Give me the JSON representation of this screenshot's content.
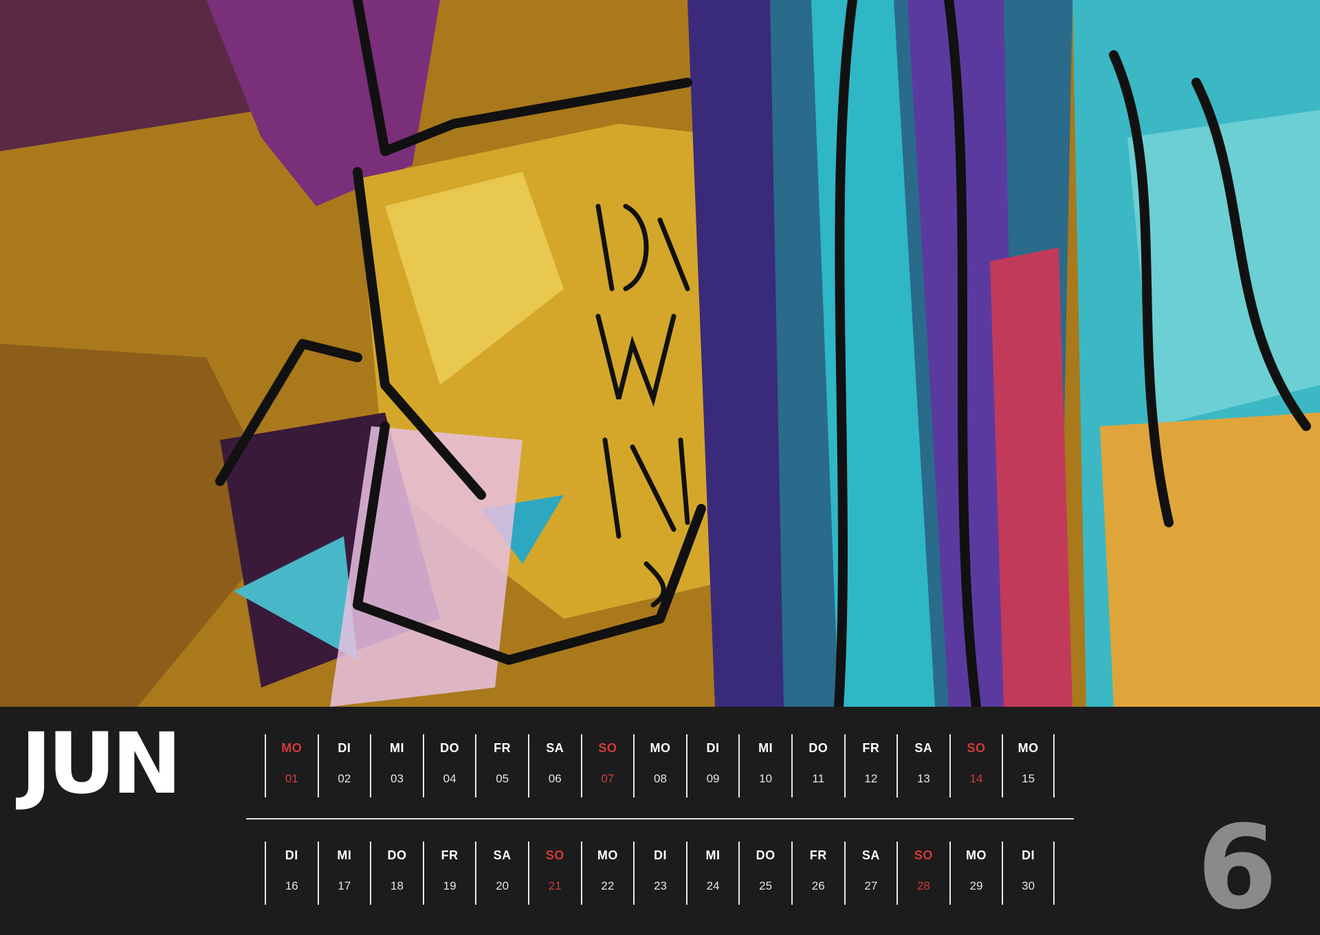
{
  "month": {
    "name": "JUN",
    "number": "6"
  },
  "colors": {
    "background": "#1c1c1c",
    "text": "#ffffff",
    "sunday": "#d23a3a",
    "month_number": "#8a8a8a"
  },
  "photo": {
    "subject": "graffiti-wall-photo"
  },
  "weeks": [
    [
      {
        "weekday": "MO",
        "day": "01",
        "sunday": true
      },
      {
        "weekday": "DI",
        "day": "02",
        "sunday": false
      },
      {
        "weekday": "MI",
        "day": "03",
        "sunday": false
      },
      {
        "weekday": "DO",
        "day": "04",
        "sunday": false
      },
      {
        "weekday": "FR",
        "day": "05",
        "sunday": false
      },
      {
        "weekday": "SA",
        "day": "06",
        "sunday": false
      },
      {
        "weekday": "SO",
        "day": "07",
        "sunday": true
      },
      {
        "weekday": "MO",
        "day": "08",
        "sunday": false
      },
      {
        "weekday": "DI",
        "day": "09",
        "sunday": false
      },
      {
        "weekday": "MI",
        "day": "10",
        "sunday": false
      },
      {
        "weekday": "DO",
        "day": "11",
        "sunday": false
      },
      {
        "weekday": "FR",
        "day": "12",
        "sunday": false
      },
      {
        "weekday": "SA",
        "day": "13",
        "sunday": false
      },
      {
        "weekday": "SO",
        "day": "14",
        "sunday": true
      },
      {
        "weekday": "MO",
        "day": "15",
        "sunday": false
      }
    ],
    [
      {
        "weekday": "DI",
        "day": "16",
        "sunday": false
      },
      {
        "weekday": "MI",
        "day": "17",
        "sunday": false
      },
      {
        "weekday": "DO",
        "day": "18",
        "sunday": false
      },
      {
        "weekday": "FR",
        "day": "19",
        "sunday": false
      },
      {
        "weekday": "SA",
        "day": "20",
        "sunday": false
      },
      {
        "weekday": "SO",
        "day": "21",
        "sunday": true
      },
      {
        "weekday": "MO",
        "day": "22",
        "sunday": false
      },
      {
        "weekday": "DI",
        "day": "23",
        "sunday": false
      },
      {
        "weekday": "MI",
        "day": "24",
        "sunday": false
      },
      {
        "weekday": "DO",
        "day": "25",
        "sunday": false
      },
      {
        "weekday": "FR",
        "day": "26",
        "sunday": false
      },
      {
        "weekday": "SA",
        "day": "27",
        "sunday": false
      },
      {
        "weekday": "SO",
        "day": "28",
        "sunday": true
      },
      {
        "weekday": "MO",
        "day": "29",
        "sunday": false
      },
      {
        "weekday": "DI",
        "day": "30",
        "sunday": false
      }
    ]
  ]
}
